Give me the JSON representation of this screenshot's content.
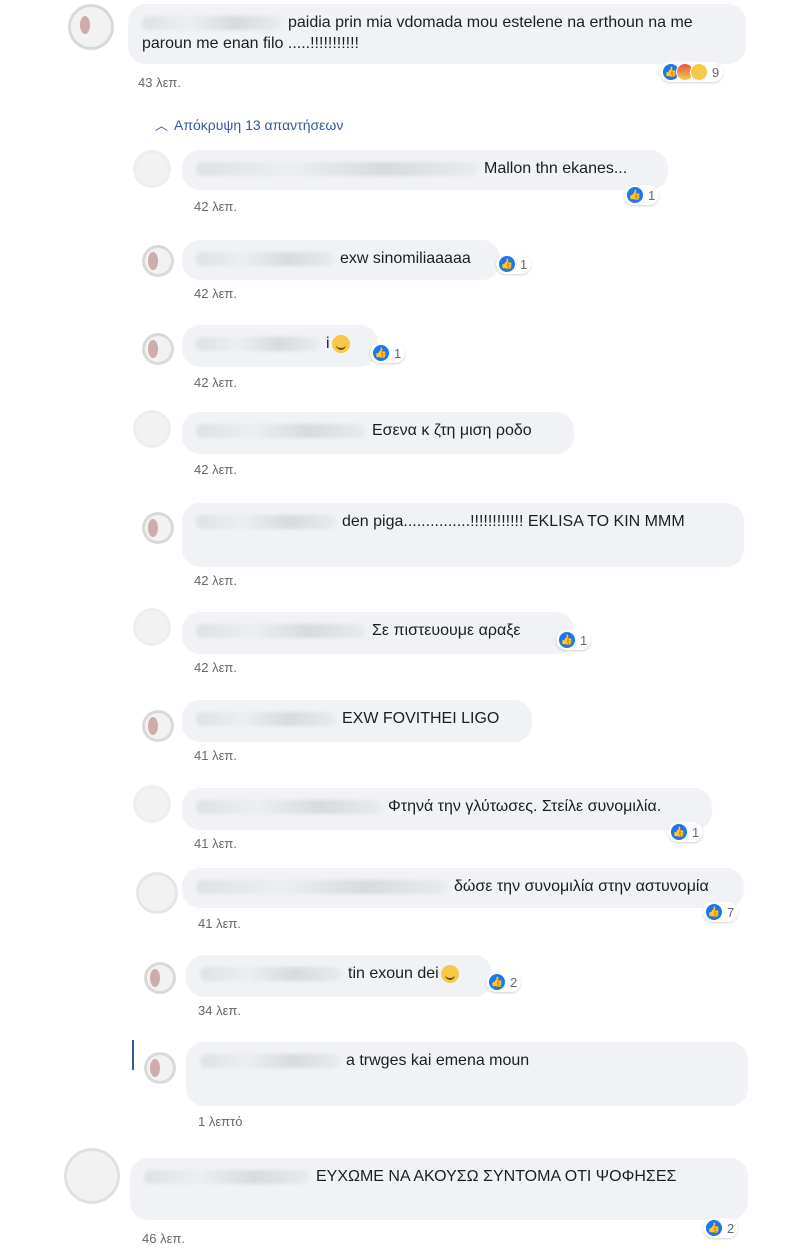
{
  "hide_replies": "Απόκρυψη 13 απαντήσεων",
  "comments": [
    {
      "text": "paidia prin mia vdomada mou estelene na erthoun na me paroun me enan filo .....!!!!!!!!!!!",
      "time": "43 λεπ.",
      "reactions": "9"
    },
    {
      "text": "Mallon thn ekanes...",
      "time": "42 λεπ.",
      "reactions": "1"
    },
    {
      "text": "exw sinomiliaaaaa",
      "time": "42 λεπ.",
      "reactions": "1"
    },
    {
      "text": "i",
      "time": "42 λεπ.",
      "reactions": "1"
    },
    {
      "text": "Εσενα κ ζτη μιση ροδο",
      "time": "42 λεπ.",
      "reactions": ""
    },
    {
      "text": "den piga...............!!!!!!!!!!!! EKLISA TO KIN MMM",
      "time": "42 λεπ.",
      "reactions": ""
    },
    {
      "text": "Σε πιστευουμε αραξε",
      "time": "42 λεπ.",
      "reactions": "1"
    },
    {
      "text": "EXW FOVITHEI LIGO",
      "time": "41 λεπ.",
      "reactions": ""
    },
    {
      "text": "Φτηνά την γλύτωσες. Στείλε συνομιλία.",
      "time": "41 λεπ.",
      "reactions": "1"
    },
    {
      "text": "δώσε την συνομιλία στην αστυνομία",
      "time": "41 λεπ.",
      "reactions": "7"
    },
    {
      "text": "tin exoun dei",
      "time": "34 λεπ.",
      "reactions": "2"
    },
    {
      "text": "a trwges kai emena moun",
      "time": "1 λεπτό",
      "reactions": ""
    },
    {
      "text": "ΕΥΧΩΜΕ ΝΑ ΑΚΟΥΣΩ ΣΥΝΤΟΜΑ ΟΤΙ ΨΟΦΗΣΕΣ",
      "time": "46 λεπ.",
      "reactions": "2"
    }
  ]
}
